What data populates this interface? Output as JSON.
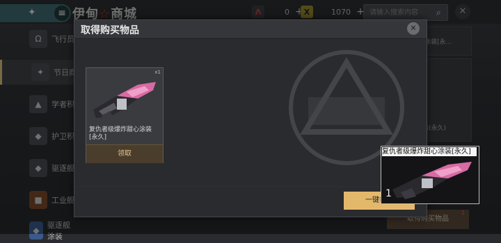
{
  "store": {
    "title_left": "伊甸",
    "title_star": "☆",
    "title_right": "商城",
    "currency_red": "0",
    "currency_gold": "1070",
    "search_placeholder": "请输入搜索内容",
    "buy_list_button": "取得购买物品",
    "buy_list_badge": "1"
  },
  "sidebar": {
    "items": [
      {
        "label": "飞行员",
        "icon": "omega-icon"
      },
      {
        "label": "节日商",
        "icon": "party-popper-icon"
      },
      {
        "label": "学者积",
        "icon": "scholar-icon"
      },
      {
        "label": "护卫积",
        "icon": "guard-ship-icon"
      },
      {
        "label": "驱逐舰",
        "icon": "destroyer-icon"
      },
      {
        "label": "工业舰",
        "icon": "industrial-ship-icon"
      },
      {
        "label": "驱逐舰涂装",
        "icon": "paint-icon"
      }
    ]
  },
  "right_cards": {
    "card1_label": "心涂装[永...",
    "card2_label": "装(永久)"
  },
  "modal": {
    "title": "取得购买物品",
    "item": {
      "count": "x1",
      "name": "复仇者级爆炸甜心涂装[永久]",
      "claim_label": "领取"
    },
    "claim_all_label": "一键领取"
  },
  "drag_preview": {
    "name": "复仇者级爆炸甜心涂装[永久]",
    "count": "1"
  },
  "colors": {
    "accent_gold": "#e4b86b",
    "teal": "#3e6a6f",
    "pink": "#e06aa8"
  }
}
